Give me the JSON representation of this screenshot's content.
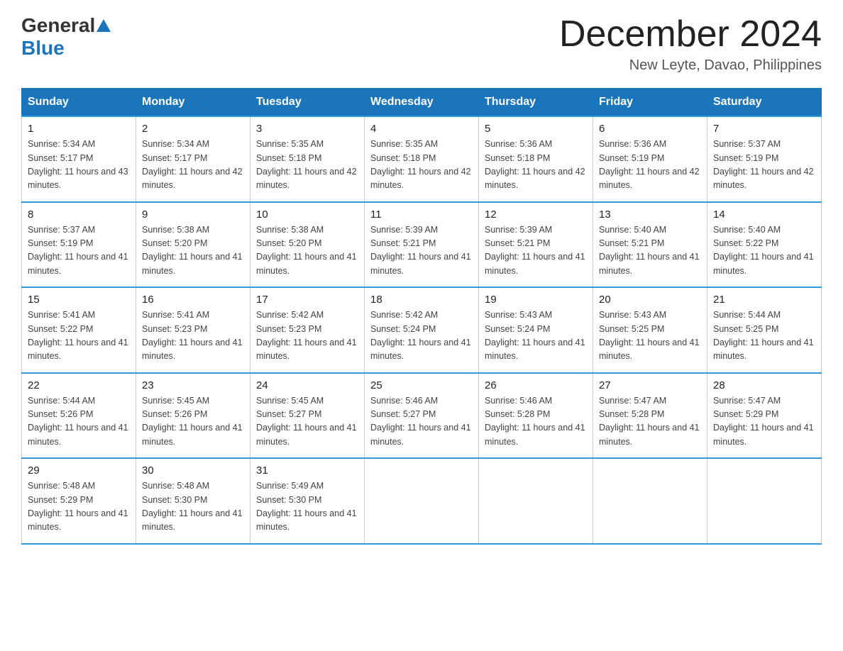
{
  "header": {
    "logo_general": "General",
    "logo_blue": "Blue",
    "month_title": "December 2024",
    "subtitle": "New Leyte, Davao, Philippines"
  },
  "weekdays": [
    "Sunday",
    "Monday",
    "Tuesday",
    "Wednesday",
    "Thursday",
    "Friday",
    "Saturday"
  ],
  "weeks": [
    [
      {
        "day": "1",
        "sunrise": "5:34 AM",
        "sunset": "5:17 PM",
        "daylight": "11 hours and 43 minutes."
      },
      {
        "day": "2",
        "sunrise": "5:34 AM",
        "sunset": "5:17 PM",
        "daylight": "11 hours and 42 minutes."
      },
      {
        "day": "3",
        "sunrise": "5:35 AM",
        "sunset": "5:18 PM",
        "daylight": "11 hours and 42 minutes."
      },
      {
        "day": "4",
        "sunrise": "5:35 AM",
        "sunset": "5:18 PM",
        "daylight": "11 hours and 42 minutes."
      },
      {
        "day": "5",
        "sunrise": "5:36 AM",
        "sunset": "5:18 PM",
        "daylight": "11 hours and 42 minutes."
      },
      {
        "day": "6",
        "sunrise": "5:36 AM",
        "sunset": "5:19 PM",
        "daylight": "11 hours and 42 minutes."
      },
      {
        "day": "7",
        "sunrise": "5:37 AM",
        "sunset": "5:19 PM",
        "daylight": "11 hours and 42 minutes."
      }
    ],
    [
      {
        "day": "8",
        "sunrise": "5:37 AM",
        "sunset": "5:19 PM",
        "daylight": "11 hours and 41 minutes."
      },
      {
        "day": "9",
        "sunrise": "5:38 AM",
        "sunset": "5:20 PM",
        "daylight": "11 hours and 41 minutes."
      },
      {
        "day": "10",
        "sunrise": "5:38 AM",
        "sunset": "5:20 PM",
        "daylight": "11 hours and 41 minutes."
      },
      {
        "day": "11",
        "sunrise": "5:39 AM",
        "sunset": "5:21 PM",
        "daylight": "11 hours and 41 minutes."
      },
      {
        "day": "12",
        "sunrise": "5:39 AM",
        "sunset": "5:21 PM",
        "daylight": "11 hours and 41 minutes."
      },
      {
        "day": "13",
        "sunrise": "5:40 AM",
        "sunset": "5:21 PM",
        "daylight": "11 hours and 41 minutes."
      },
      {
        "day": "14",
        "sunrise": "5:40 AM",
        "sunset": "5:22 PM",
        "daylight": "11 hours and 41 minutes."
      }
    ],
    [
      {
        "day": "15",
        "sunrise": "5:41 AM",
        "sunset": "5:22 PM",
        "daylight": "11 hours and 41 minutes."
      },
      {
        "day": "16",
        "sunrise": "5:41 AM",
        "sunset": "5:23 PM",
        "daylight": "11 hours and 41 minutes."
      },
      {
        "day": "17",
        "sunrise": "5:42 AM",
        "sunset": "5:23 PM",
        "daylight": "11 hours and 41 minutes."
      },
      {
        "day": "18",
        "sunrise": "5:42 AM",
        "sunset": "5:24 PM",
        "daylight": "11 hours and 41 minutes."
      },
      {
        "day": "19",
        "sunrise": "5:43 AM",
        "sunset": "5:24 PM",
        "daylight": "11 hours and 41 minutes."
      },
      {
        "day": "20",
        "sunrise": "5:43 AM",
        "sunset": "5:25 PM",
        "daylight": "11 hours and 41 minutes."
      },
      {
        "day": "21",
        "sunrise": "5:44 AM",
        "sunset": "5:25 PM",
        "daylight": "11 hours and 41 minutes."
      }
    ],
    [
      {
        "day": "22",
        "sunrise": "5:44 AM",
        "sunset": "5:26 PM",
        "daylight": "11 hours and 41 minutes."
      },
      {
        "day": "23",
        "sunrise": "5:45 AM",
        "sunset": "5:26 PM",
        "daylight": "11 hours and 41 minutes."
      },
      {
        "day": "24",
        "sunrise": "5:45 AM",
        "sunset": "5:27 PM",
        "daylight": "11 hours and 41 minutes."
      },
      {
        "day": "25",
        "sunrise": "5:46 AM",
        "sunset": "5:27 PM",
        "daylight": "11 hours and 41 minutes."
      },
      {
        "day": "26",
        "sunrise": "5:46 AM",
        "sunset": "5:28 PM",
        "daylight": "11 hours and 41 minutes."
      },
      {
        "day": "27",
        "sunrise": "5:47 AM",
        "sunset": "5:28 PM",
        "daylight": "11 hours and 41 minutes."
      },
      {
        "day": "28",
        "sunrise": "5:47 AM",
        "sunset": "5:29 PM",
        "daylight": "11 hours and 41 minutes."
      }
    ],
    [
      {
        "day": "29",
        "sunrise": "5:48 AM",
        "sunset": "5:29 PM",
        "daylight": "11 hours and 41 minutes."
      },
      {
        "day": "30",
        "sunrise": "5:48 AM",
        "sunset": "5:30 PM",
        "daylight": "11 hours and 41 minutes."
      },
      {
        "day": "31",
        "sunrise": "5:49 AM",
        "sunset": "5:30 PM",
        "daylight": "11 hours and 41 minutes."
      },
      null,
      null,
      null,
      null
    ]
  ],
  "labels": {
    "sunrise": "Sunrise:",
    "sunset": "Sunset:",
    "daylight": "Daylight:"
  }
}
